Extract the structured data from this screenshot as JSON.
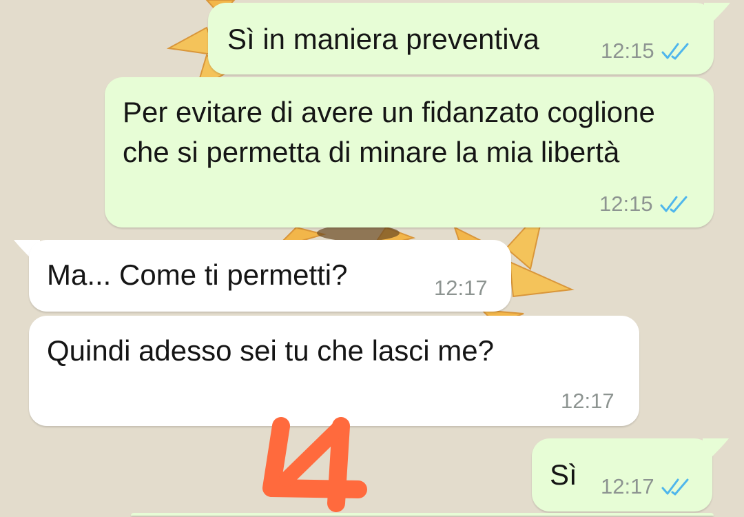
{
  "chat": {
    "messages": [
      {
        "direction": "outgoing",
        "text": "Sì in maniera preventiva",
        "time": "12:15",
        "status_icon": "double-check-read-icon"
      },
      {
        "direction": "outgoing",
        "text": "Per evitare di avere un fidanzato coglione che si permetta di minare la mia libertà",
        "time": "12:15",
        "status_icon": "double-check-read-icon"
      },
      {
        "direction": "incoming",
        "text": "Ma... Come ti permetti?",
        "time": "12:17"
      },
      {
        "direction": "incoming",
        "text": "Quindi adesso sei tu che lasci me?",
        "time": "12:17"
      },
      {
        "direction": "outgoing",
        "text": "Sì",
        "time": "12:17",
        "status_icon": "double-check-read-icon"
      }
    ]
  },
  "colors": {
    "wallpaper": "#e3dccc",
    "outgoing_bubble": "#e7fdd6",
    "incoming_bubble": "#ffffff",
    "read_ticks": "#4fb6ec",
    "timestamp": "#8d9491",
    "sunflower_petal": "#f2b64a",
    "annotation_mark": "#ff6a3d"
  }
}
